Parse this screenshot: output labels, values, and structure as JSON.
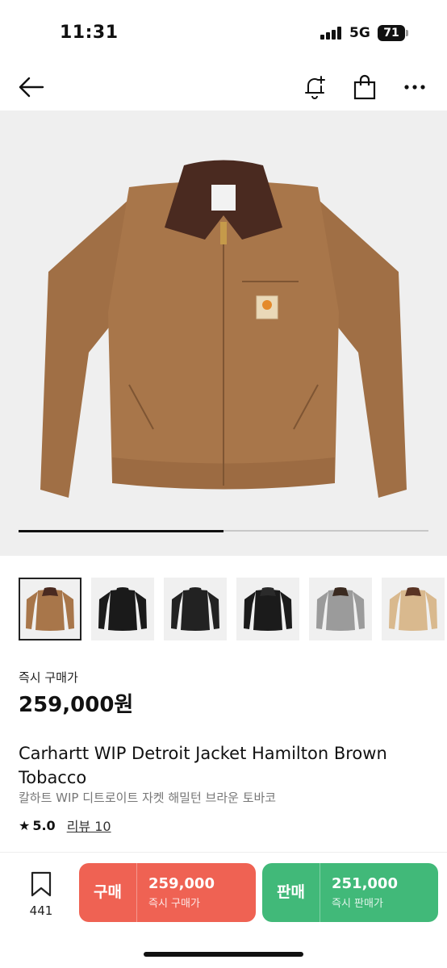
{
  "status": {
    "time": "11:31",
    "network": "5G",
    "battery": "71"
  },
  "gallery": {
    "progress": 0.5
  },
  "product": {
    "instant_label": "즉시 구매가",
    "price": "259,000원",
    "title": "Carhartt WIP Detroit Jacket Hamilton Brown Tobacco",
    "subtitle": "칼하트 WIP 디트로이트 자켓 해밀턴 브라운 토바코",
    "rating": "5.0",
    "review": "리뷰 10"
  },
  "bookmark": {
    "count": "441"
  },
  "buy": {
    "label": "구매",
    "amount": "259,000",
    "sub": "즉시 구매가"
  },
  "sell": {
    "label": "판매",
    "amount": "251,000",
    "sub": "즉시 판매가"
  },
  "thumbnails": [
    {
      "color": "#a8764a",
      "collar": "#4a2a20"
    },
    {
      "color": "#1a1a1a",
      "collar": "#1a1a1a"
    },
    {
      "color": "#222222",
      "collar": "#222222"
    },
    {
      "color": "#1b1b1b",
      "collar": "#2a2a2a"
    },
    {
      "color": "#9b9b9b",
      "collar": "#3a2a20"
    },
    {
      "color": "#d9b98e",
      "collar": "#5a3424"
    }
  ],
  "colors": {
    "buy": "#ef6253",
    "sell": "#41b979",
    "jacket": "#a8764a",
    "collar": "#4a2a20"
  }
}
